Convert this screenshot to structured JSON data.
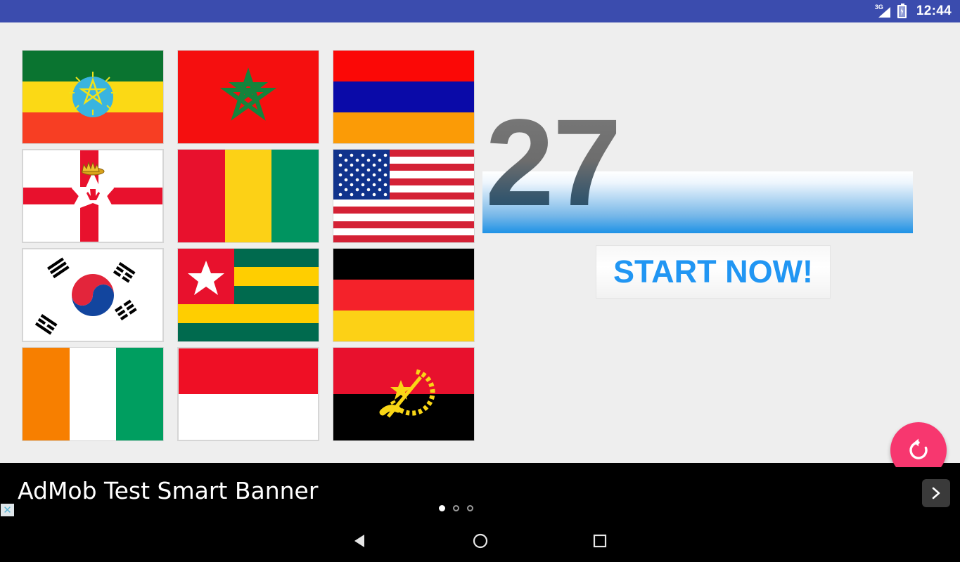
{
  "status_bar": {
    "network_label": "3G",
    "signal_icon": "signal-3g-icon",
    "battery_icon": "battery-charging-icon",
    "time": "12:44"
  },
  "game": {
    "score": "27",
    "start_button_label": "START NOW!",
    "restart_icon": "restart-icon",
    "accent_color": "#2196f3",
    "fab_color": "#f7376f",
    "background_color": "#eeeeee",
    "flags": [
      {
        "name": "Ethiopia",
        "icon": "flag-ethiopia"
      },
      {
        "name": "Morocco",
        "icon": "flag-morocco"
      },
      {
        "name": "Armenia",
        "icon": "flag-armenia"
      },
      {
        "name": "Northern Ireland",
        "icon": "flag-northern-ireland"
      },
      {
        "name": "Guinea",
        "icon": "flag-guinea"
      },
      {
        "name": "United States",
        "icon": "flag-united-states"
      },
      {
        "name": "South Korea",
        "icon": "flag-south-korea"
      },
      {
        "name": "Togo",
        "icon": "flag-togo"
      },
      {
        "name": "Germany",
        "icon": "flag-germany"
      },
      {
        "name": "Ivory Coast",
        "icon": "flag-ivory-coast"
      },
      {
        "name": "Indonesia",
        "icon": "flag-indonesia"
      },
      {
        "name": "Angola",
        "icon": "flag-angola"
      }
    ]
  },
  "ad_banner": {
    "text": "AdMob Test Smart Banner",
    "close_label": "✕",
    "next_icon": "chevron-right-icon",
    "dots": [
      "active",
      "inactive",
      "inactive"
    ]
  },
  "nav_bar": {
    "back_icon": "back-triangle-icon",
    "home_icon": "home-circle-icon",
    "recents_icon": "recents-square-icon"
  }
}
